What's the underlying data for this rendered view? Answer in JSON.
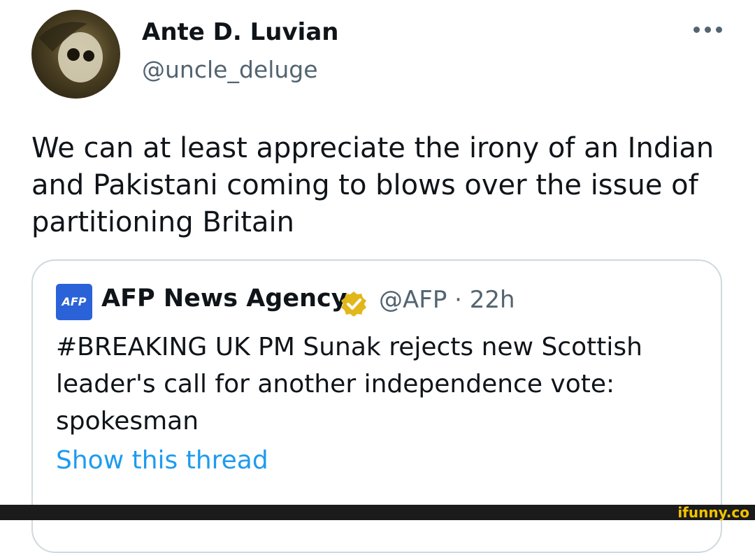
{
  "post": {
    "author_name": "Ante D. Luvian",
    "author_handle": "@uncle_deluge",
    "text": "We can at least appreciate the irony of an Indian\nand Pakistani coming to blows over the issue of\npartitioning Britain"
  },
  "quoted": {
    "logo_text": "AFP",
    "author_name": "AFP News Agency",
    "author_handle_time": "@AFP · 22h",
    "text": "#BREAKING UK PM Sunak rejects new Scottish\nleader's call for another independence vote:\nspokesman",
    "show_thread": "Show this thread"
  },
  "watermark": "ifunny.co",
  "colors": {
    "link": "#1d9bf0",
    "secondary": "#536471",
    "afp_blue": "#2b62d8",
    "verified_gold": "#e2b719"
  }
}
